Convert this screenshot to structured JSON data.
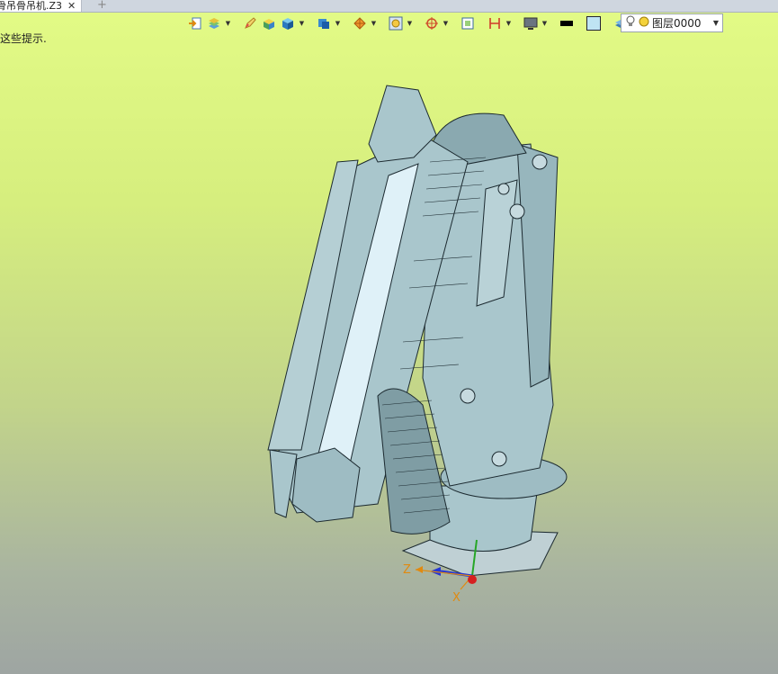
{
  "tab": {
    "title": "骨吊骨吊机.Z3",
    "close": "✕",
    "add": "+"
  },
  "hint_text": "这些提示.",
  "toolbar": {
    "icons": [
      "import-icon",
      "layers-icon",
      "pencil-icon",
      "box-colored-icon",
      "cube-icon",
      "cube-blue-icon",
      "pie-style-icon",
      "render-mode-icon",
      "target-icon",
      "frame-icon",
      "dimension-icon",
      "monitor-icon",
      "line-color",
      "fill-color",
      "stack-icon"
    ],
    "line_color": "#000000",
    "fill_color": "#bfe4f3"
  },
  "layer": {
    "icon_bulb": "bulb-icon",
    "icon_state": "circle-icon",
    "name": "图层0000"
  },
  "axes": {
    "z": "Z",
    "x": "X"
  },
  "colors": {
    "model": "#a9c6cc",
    "model_dark": "#7f9da4",
    "panel": "#dff1f8",
    "bg_top": "#e3fb86",
    "bg_bottom": "#9ea5a2"
  }
}
